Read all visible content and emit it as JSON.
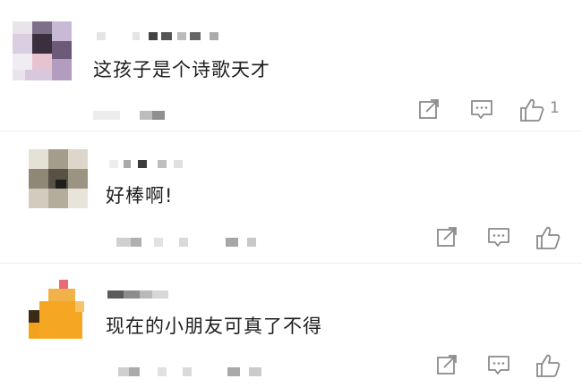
{
  "comments": [
    {
      "text": "这孩子是个诗歌天才",
      "like_count": "1",
      "icons": {
        "forward": "share-square-icon",
        "reply": "comment-bubble-icon",
        "like": "thumbs-up-icon"
      }
    },
    {
      "text": "好棒啊!",
      "like_count": "",
      "icons": {
        "forward": "share-square-icon",
        "reply": "comment-bubble-icon",
        "like": "thumbs-up-icon"
      }
    },
    {
      "text": "现在的小朋友可真了不得",
      "like_count": "",
      "icons": {
        "forward": "share-square-icon",
        "reply": "comment-bubble-icon",
        "like": "thumbs-up-icon"
      }
    }
  ],
  "colors": {
    "text": "#1e1e1e",
    "icon": "#8a8a8a",
    "blur": "#d0d0d0",
    "divider": "#efefef",
    "avatar3_orange": "#f5a623"
  }
}
